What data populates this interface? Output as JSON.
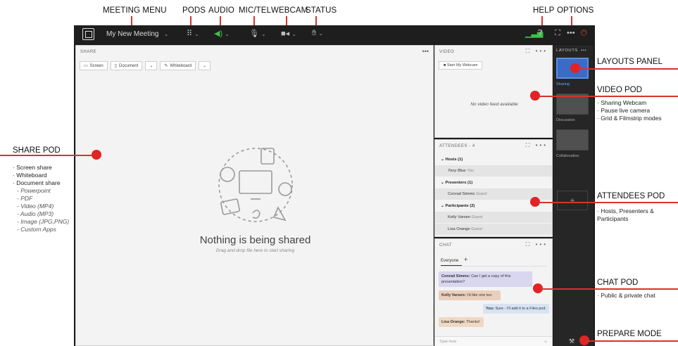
{
  "top_callouts": {
    "meeting_menu": "MEETING MENU",
    "pods": "PODS",
    "audio": "AUDIO",
    "mic_tel": "MIC/TEL",
    "webcam": "WEBCAM",
    "status": "STATUS",
    "help": "HELP",
    "options": "OPTIONS"
  },
  "topbar": {
    "meeting_title": "My New Meeting"
  },
  "share_pod": {
    "header": "SHARE",
    "buttons": [
      "Screen",
      "Document",
      "Whiteboard"
    ],
    "empty_title": "Nothing is being shared",
    "empty_subtitle": "Drag and drop file here to start sharing"
  },
  "video_pod": {
    "header": "VIDEO",
    "start_button": "Start My Webcam",
    "no_feed": "No video feed available"
  },
  "attendees_pod": {
    "header": "ATTENDEES - 4",
    "groups": [
      {
        "label": "Hosts (1)",
        "people": [
          {
            "name": "Tony Blue",
            "role": "You"
          }
        ]
      },
      {
        "label": "Presenters (1)",
        "people": [
          {
            "name": "Conrad Simms",
            "role": "Guest"
          }
        ]
      },
      {
        "label": "Participants (2)",
        "people": [
          {
            "name": "Kelly Varsen",
            "role": "Guest"
          },
          {
            "name": "Lisa Orange",
            "role": "Guest"
          }
        ]
      }
    ]
  },
  "chat_pod": {
    "header": "CHAT",
    "tab": "Everyone",
    "add_tab": "+",
    "messages": [
      {
        "sender": "Conrad Simms:",
        "text": "Can I get a copy of this presentation?"
      },
      {
        "sender": "Kelly Varsen:",
        "text": "I'd like one too"
      },
      {
        "sender": "You:",
        "text": "Sure - I'll add it to a Files pod."
      },
      {
        "sender": "Lisa Orange:",
        "text": "Thanks!"
      }
    ],
    "input_placeholder": "Type here"
  },
  "layouts_panel": {
    "header": "LAYOUTS",
    "layouts": [
      "Sharing",
      "Discussion",
      "Collaboration"
    ],
    "add": "+"
  },
  "right_callouts": {
    "layouts_panel": "LAYOUTS PANEL",
    "video_pod": "VIDEO POD",
    "video_items": [
      "· Sharing Webcam",
      "· Pause live camera",
      "· Grid & Filmstrip modes"
    ],
    "attendees_pod": "ATTENDEES POD",
    "attendees_items": [
      "· Hosts, Presenters &",
      "  Participants"
    ],
    "chat_pod": "CHAT POD",
    "chat_items": [
      "· Public & private chat"
    ],
    "prepare_mode": "PREPARE MODE"
  },
  "left_callout": {
    "title": "SHARE POD",
    "items": [
      "· Screen share",
      "· Whiteboard",
      "· Document share"
    ],
    "subitems": [
      "- Powerpoint",
      "- PDF",
      "- Video (MP4)",
      "- Audio (MP3)",
      "- Image (JPG,PNG)",
      "- Custom Apps"
    ]
  },
  "colors": {
    "accent_red": "#e02424",
    "app_bg": "#1b1b1b",
    "active_layout": "#3b6bc4",
    "audio_green": "#3fbf4a"
  }
}
